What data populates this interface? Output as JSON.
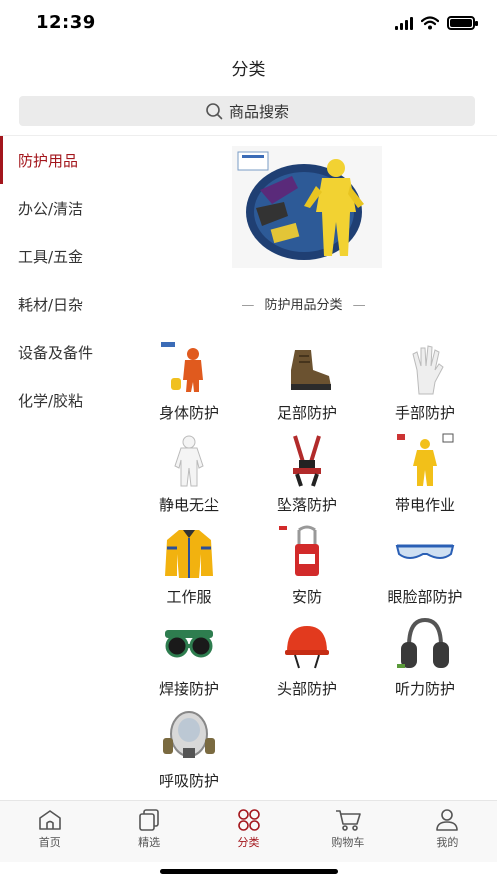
{
  "status_bar": {
    "time": "12:39"
  },
  "header": {
    "title": "分类"
  },
  "search": {
    "placeholder": "商品搜索",
    "icon": "search-icon"
  },
  "sidebar": {
    "active_index": 0,
    "items": [
      {
        "label": "防护用品"
      },
      {
        "label": "办公/清洁"
      },
      {
        "label": "工具/五金"
      },
      {
        "label": "耗材/日杂"
      },
      {
        "label": "设备及备件"
      },
      {
        "label": "化学/胶粘"
      }
    ]
  },
  "main": {
    "section_title": "防护用品分类",
    "section_dash": "—",
    "categories": [
      {
        "label": "身体防护"
      },
      {
        "label": "足部防护"
      },
      {
        "label": "手部防护"
      },
      {
        "label": "静电无尘"
      },
      {
        "label": "坠落防护"
      },
      {
        "label": "带电作业"
      },
      {
        "label": "工作服"
      },
      {
        "label": "安防"
      },
      {
        "label": "眼脸部防护"
      },
      {
        "label": "焊接防护"
      },
      {
        "label": "头部防护"
      },
      {
        "label": "听力防护"
      },
      {
        "label": "呼吸防护"
      }
    ]
  },
  "tab_bar": {
    "active_index": 2,
    "tabs": [
      {
        "label": "首页",
        "icon": "home-icon"
      },
      {
        "label": "精选",
        "icon": "copy-icon"
      },
      {
        "label": "分类",
        "icon": "grid-circles-icon"
      },
      {
        "label": "购物车",
        "icon": "cart-icon"
      },
      {
        "label": "我的",
        "icon": "user-icon"
      }
    ]
  },
  "colors": {
    "accent": "#a3161c",
    "search_bg": "#ebebeb",
    "tab_bg": "#f8f8f8"
  }
}
